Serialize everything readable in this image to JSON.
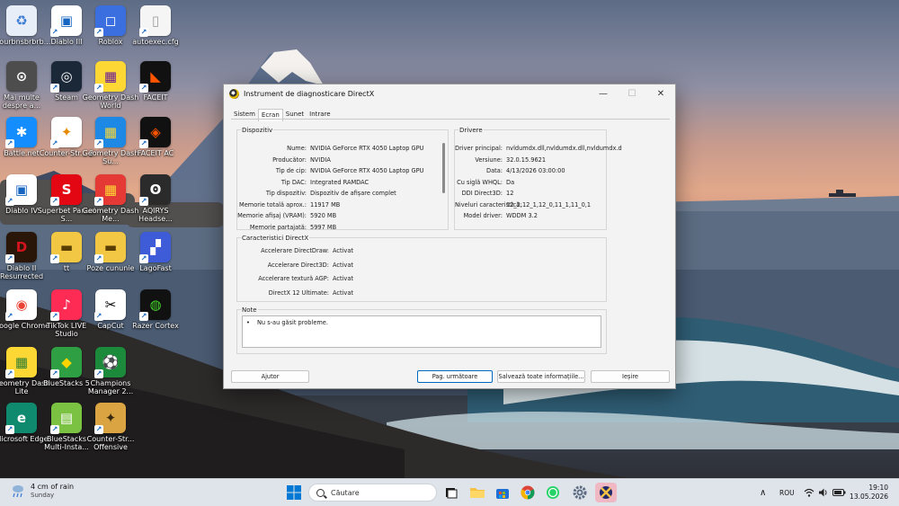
{
  "desktop": {
    "icons": [
      {
        "label": "g ourbnsbrbrb...",
        "color": "#e8eef7",
        "glyph": "♻",
        "fg": "#3a7bd5"
      },
      {
        "label": "Mai multe despre a...",
        "color": "#4d4d4d",
        "glyph": "⊙",
        "fg": "#ffffff"
      },
      {
        "label": "Battle.net",
        "color": "#148eff",
        "glyph": "✱",
        "fg": "#ffffff"
      },
      {
        "label": "Diablo IV",
        "color": "#ffffff",
        "glyph": "▣",
        "fg": "#1565c0"
      },
      {
        "label": "Diablo II Resurrected",
        "color": "#2a1608",
        "glyph": "D",
        "fg": "#d4141c"
      },
      {
        "label": "Google Chrome",
        "color": "#ffffff",
        "glyph": "◉",
        "fg": "#ea4335"
      },
      {
        "label": "Geometry Dash Lite",
        "color": "#fdd835",
        "glyph": "▦",
        "fg": "#2e7d32"
      },
      {
        "label": "Microsoft Edge",
        "color": "#0f8a6e",
        "glyph": "e",
        "fg": "#ffffff"
      },
      {
        "label": "Diablo III",
        "color": "#ffffff",
        "glyph": "▣",
        "fg": "#1565c0"
      },
      {
        "label": "Steam",
        "color": "#1b2838",
        "glyph": "◎",
        "fg": "#ffffff"
      },
      {
        "label": "Counter-Str... 2",
        "color": "#ffffff",
        "glyph": "✦",
        "fg": "#e68a00"
      },
      {
        "label": "Superbet Pariuri S...",
        "color": "#e30613",
        "glyph": "S",
        "fg": "#ffffff"
      },
      {
        "label": "tt",
        "color": "#f2c744",
        "glyph": "▬",
        "fg": "#5a3d00"
      },
      {
        "label": "TikTok LIVE Studio",
        "color": "#fe2c55",
        "glyph": "♪",
        "fg": "#ffffff"
      },
      {
        "label": "BlueStacks 5",
        "color": "#2ea043",
        "glyph": "◆",
        "fg": "#ffd400"
      },
      {
        "label": "BlueStacks Multi-Insta...",
        "color": "#7cc242",
        "glyph": "▤",
        "fg": "#ffffff"
      },
      {
        "label": "Roblox",
        "color": "#3b6fe0",
        "glyph": "◻",
        "fg": "#ffffff"
      },
      {
        "label": "Geometry Dash World",
        "color": "#fdd835",
        "glyph": "▦",
        "fg": "#6a1b9a"
      },
      {
        "label": "Geometry Dash Su...",
        "color": "#1e88e5",
        "glyph": "▦",
        "fg": "#fdd835"
      },
      {
        "label": "Geometry Dash Me...",
        "color": "#e53935",
        "glyph": "▦",
        "fg": "#fdd835"
      },
      {
        "label": "Poze cununie",
        "color": "#f2c744",
        "glyph": "▬",
        "fg": "#5a3d00"
      },
      {
        "label": "CapCut",
        "color": "#ffffff",
        "glyph": "✂",
        "fg": "#000000"
      },
      {
        "label": "Champions Manager 2...",
        "color": "#1b8a3a",
        "glyph": "⚽",
        "fg": "#ffffff"
      },
      {
        "label": "Counter-Str... Offensive",
        "color": "#d9a441",
        "glyph": "✦",
        "fg": "#3b2a10"
      },
      {
        "label": "autoexec.cfg",
        "color": "#f5f5f5",
        "glyph": "▯",
        "fg": "#9e9e9e"
      },
      {
        "label": "FACEIT",
        "color": "#111111",
        "glyph": "◣",
        "fg": "#ff5500"
      },
      {
        "label": "FACEIT AC",
        "color": "#111111",
        "glyph": "◈",
        "fg": "#ff5500"
      },
      {
        "label": "AQIRYS Headse...",
        "color": "#2b2b2b",
        "glyph": "ʘ",
        "fg": "#ffffff"
      },
      {
        "label": "LagoFast",
        "color": "#3e5bd8",
        "glyph": "▞",
        "fg": "#ffffff"
      },
      {
        "label": "Razer Cortex",
        "color": "#111111",
        "glyph": "◍",
        "fg": "#44d62c"
      }
    ]
  },
  "dialog": {
    "title": "Instrument de diagnosticare DirectX",
    "minimize": "—",
    "maximize": "☐",
    "close": "✕",
    "tabs": [
      "Sistem",
      "Ecran",
      "Sunet",
      "Intrare"
    ],
    "active_tab": "Ecran",
    "device": {
      "title": "Dispozitiv",
      "rows": [
        {
          "k": "Nume:",
          "v": "NVIDIA GeForce RTX 4050 Laptop GPU"
        },
        {
          "k": "Producător:",
          "v": "NVIDIA"
        },
        {
          "k": "Tip de cip:",
          "v": "NVIDIA GeForce RTX 4050 Laptop GPU"
        },
        {
          "k": "Tip DAC:",
          "v": "Integrated RAMDAC"
        },
        {
          "k": "Tip dispozitiv:",
          "v": "Dispozitiv de afișare complet"
        },
        {
          "k": "Memorie totală aprox.:",
          "v": "11917 MB"
        },
        {
          "k": "Memorie afișaj (VRAM):",
          "v": "5920 MB"
        },
        {
          "k": "Memorie partajată:",
          "v": "5997 MB"
        }
      ]
    },
    "drivers": {
      "title": "Drivere",
      "rows": [
        {
          "k": "Driver principal:",
          "v": "nvldumdx.dll,nvldumdx.dll,nvldumdx.d"
        },
        {
          "k": "Versiune:",
          "v": "32.0.15.9621"
        },
        {
          "k": "Data:",
          "v": "4/13/2026 03:00:00"
        },
        {
          "k": "Cu siglă WHQL:",
          "v": "Da"
        },
        {
          "k": "DDI Direct3D:",
          "v": "12"
        },
        {
          "k": "Niveluri caracteristică:",
          "v": "12_2,12_1,12_0,11_1,11_0,1"
        },
        {
          "k": "Model driver:",
          "v": "WDDM 3.2"
        }
      ]
    },
    "features": {
      "title": "Caracteristici DirectX",
      "rows": [
        {
          "k": "Accelerare DirectDraw:",
          "v": "Activat"
        },
        {
          "k": "Accelerare Direct3D:",
          "v": "Activat"
        },
        {
          "k": "Accelerare textură AGP:",
          "v": "Activat"
        },
        {
          "k": "DirectX 12 Ultimate:",
          "v": "Activat"
        }
      ]
    },
    "notes": {
      "title": "Note",
      "bullet": "•",
      "text": "Nu s-au găsit probleme."
    },
    "buttons": {
      "help": "Ajutor",
      "next": "Pag. următoare",
      "save": "Salvează toate informațiile...",
      "exit": "Ieșire"
    }
  },
  "taskbar": {
    "weather_title": "4 cm of rain",
    "weather_sub": "Sunday",
    "search_placeholder": "Căutare",
    "tray_chevron": "∧",
    "language": "ROU",
    "time": "19:10",
    "date": "13.05.2026",
    "accent": "#0067c0"
  }
}
